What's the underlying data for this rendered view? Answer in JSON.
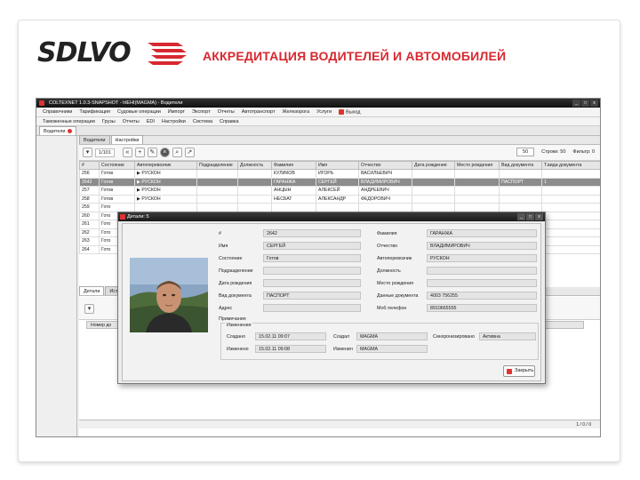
{
  "slide": {
    "title": "АККРЕДИТАЦИЯ ВОДИТЕЛЕЙ И АВТОМОБИЛЕЙ",
    "logo_text": "SDLVO",
    "accent_color": "#d7282f"
  },
  "app": {
    "window_title": "COLTEXNET 1.0.3-SNAPSHOT - hlEHI(MAGMA) - Водители",
    "menu_row1": [
      "Справочники",
      "Тарификация",
      "Судовые операции",
      "Импорт",
      "Экспорт",
      "Отчеты",
      "Автотранспорт",
      "Железорога",
      "Услуги",
      "Выход"
    ],
    "menu_row2": [
      "Таможенные операции",
      "Грузы",
      "Отчеты",
      "EDI",
      "Настройки",
      "Система",
      "Справка"
    ],
    "tabs": [
      {
        "label": "Водители"
      }
    ],
    "inner_tabs": [
      "Водители",
      "Настройки"
    ],
    "pager": "1/101",
    "rows_label": "Строки: 50",
    "rows_value": "50",
    "filter_label": "Фильтр: 0",
    "columns": [
      "#",
      "Состояние",
      "Автоперевозчик",
      "Подразделение",
      "Должность",
      "Фамилия",
      "Имя",
      "Отчество",
      "Дата рождения",
      "Место рождения",
      "Вид документа",
      "Т.вида документа"
    ],
    "rows": [
      [
        "256",
        "Готов",
        "▶ РУСКОН",
        "",
        "",
        "КУЛИКОВ",
        "ИГОРЬ",
        "ВАСИЛЬЕВИЧ",
        "",
        "",
        "",
        ""
      ],
      [
        "2642",
        "Готов",
        "▶ РУСКОН",
        "",
        "",
        "ГАРАНЖА",
        "СЕРГЕЙ",
        "ВЛАДИМИРОВИЧ",
        "",
        "",
        "ПАСПОРТ",
        "1"
      ],
      [
        "257",
        "Готов",
        "▶ РУСКОН",
        "",
        "",
        "АНЦЫН",
        "АЛЕКСЕЙ",
        "АНДРЕЕВИЧ",
        "",
        "",
        "",
        ""
      ],
      [
        "258",
        "Готов",
        "▶ РУСКОН",
        "",
        "",
        "НЕСБАТ",
        "АЛЕКСАНДР",
        "ФЕДОРОВИЧ",
        "",
        "",
        "",
        ""
      ],
      [
        "259",
        "Гото",
        "",
        "",
        "",
        "",
        "",
        "",
        "",
        "",
        "",
        ""
      ],
      [
        "260",
        "Гото",
        "",
        "",
        "",
        "",
        "",
        "",
        "",
        "",
        "",
        ""
      ],
      [
        "261",
        "Гото",
        "",
        "",
        "",
        "",
        "",
        "",
        "",
        "",
        "",
        ""
      ],
      [
        "262",
        "Гото",
        "",
        "",
        "",
        "",
        "",
        "",
        "",
        "",
        "",
        ""
      ],
      [
        "263",
        "Гото",
        "",
        "",
        "",
        "",
        "",
        "",
        "",
        "",
        "",
        ""
      ],
      [
        "264",
        "Гото",
        "",
        "",
        "",
        "",
        "",
        "",
        "",
        "",
        "",
        ""
      ]
    ],
    "lower_tabs": [
      "Детали",
      "Ист"
    ],
    "lower_column": "Номер до",
    "status_text": "1 / 0 / 0"
  },
  "dialog": {
    "title": "Детали: 5",
    "fields_left": [
      {
        "label": "#",
        "value": "2642"
      },
      {
        "label": "Имя",
        "value": "СЕРГЕЙ"
      },
      {
        "label": "Состояние",
        "value": "Готов"
      },
      {
        "label": "Подразделение",
        "value": ""
      },
      {
        "label": "Дата рождения",
        "value": ""
      },
      {
        "label": "Вид документа",
        "value": "ПАСПОРТ"
      },
      {
        "label": "Адрес",
        "value": ""
      },
      {
        "label": "Примечания",
        "value": ""
      }
    ],
    "fields_right": [
      {
        "label": "Фамилия",
        "value": "ГАРАНЖА"
      },
      {
        "label": "Отчество",
        "value": "ВЛАДИМИРОВИЧ"
      },
      {
        "label": "Автоперевозчик",
        "value": "РУСКОН"
      },
      {
        "label": "Должность",
        "value": ""
      },
      {
        "label": "Место рождения",
        "value": ""
      },
      {
        "label": "Данные документа",
        "value": "4003 756255"
      },
      {
        "label": "Моб.телефон",
        "value": "8910665555"
      }
    ],
    "history_label": "Изменения",
    "history": {
      "created_label": "Создано",
      "created_value": "15.02.11 09:07",
      "created_by_label": "Создал",
      "created_by_value": "MAGMA",
      "changed_label": "Изменено",
      "changed_value": "15.02.11 09:08",
      "changed_by_label": "Изменил",
      "changed_by_value": "MAGMA",
      "sync_label": "Синхронизировано",
      "sync_value": "Активна"
    },
    "close_label": "Закрыть"
  }
}
